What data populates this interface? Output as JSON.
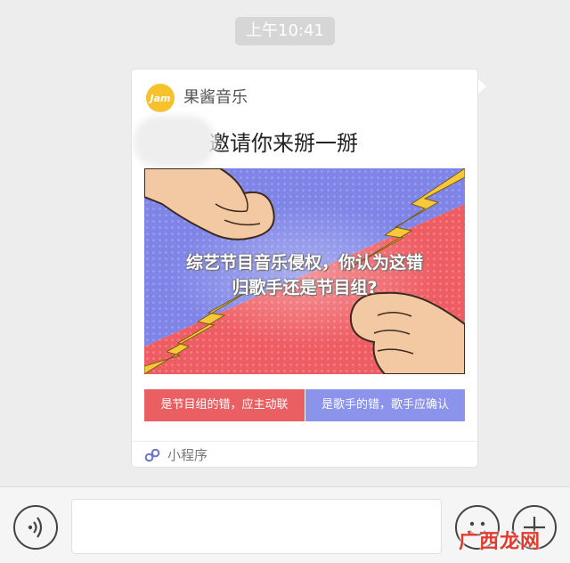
{
  "chat": {
    "timestamp": "上午10:41"
  },
  "card": {
    "app_logo_text": "Jam",
    "app_name": "果酱音乐",
    "invite_text": "邀请你来掰一掰",
    "banner": {
      "line1": "综艺节目音乐侵权，你认为这错",
      "line2": "归歌手还是节目组?"
    },
    "options": [
      {
        "label": "是节目组的错，应主动联",
        "color": "#e95f62"
      },
      {
        "label": "是歌手的错，歌手应确认",
        "color": "#8b93ea"
      }
    ],
    "footer_label": "小程序"
  },
  "input_bar": {
    "voice_icon": "voice-icon",
    "emoji_icon": "emoji-icon",
    "plus_icon": "plus-icon"
  },
  "watermark": "广西龙网"
}
